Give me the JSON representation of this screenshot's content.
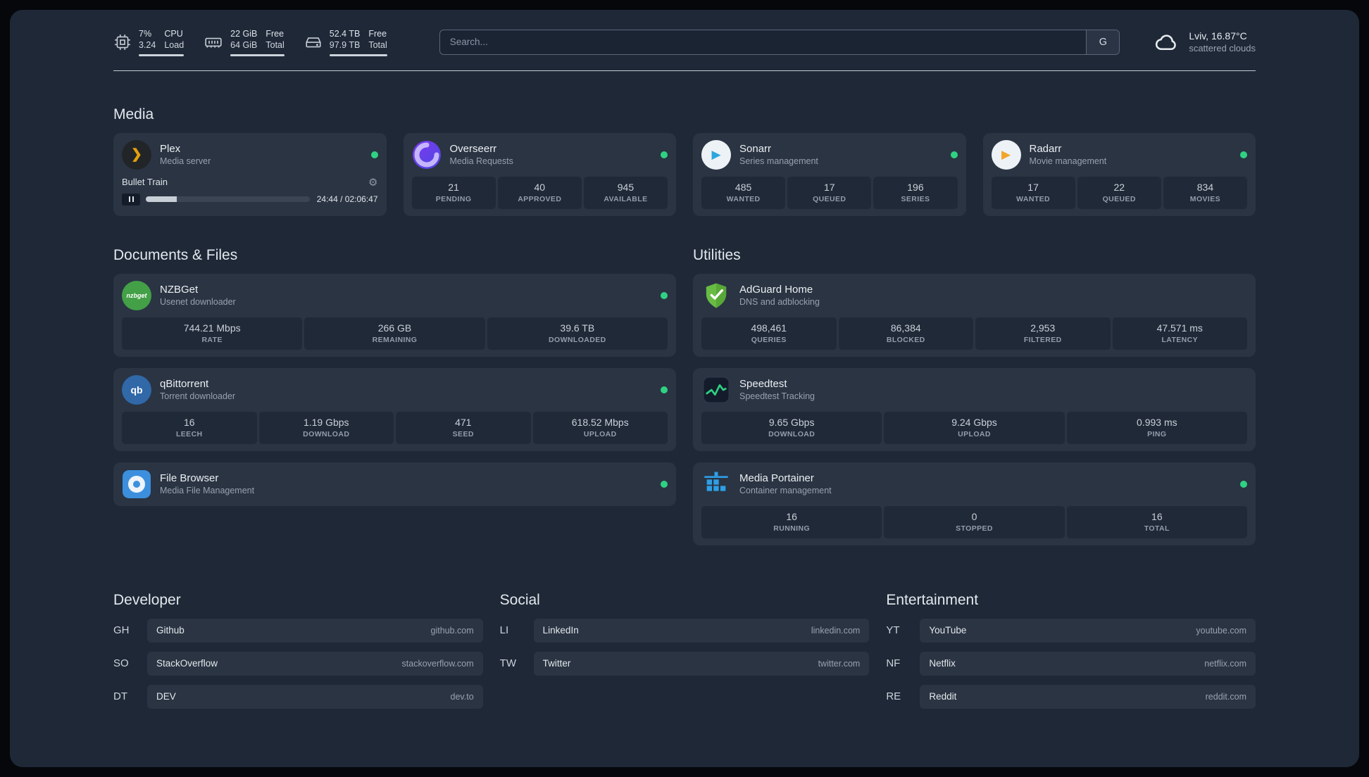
{
  "header": {
    "cpu": {
      "col1": {
        "top": "7%",
        "bottom": "3.24"
      },
      "col2": {
        "top": "CPU",
        "bottom": "Load"
      }
    },
    "memory": {
      "col1": {
        "top": "22 GiB",
        "bottom": "64 GiB"
      },
      "col2": {
        "top": "Free",
        "bottom": "Total"
      }
    },
    "disk": {
      "col1": {
        "top": "52.4 TB",
        "bottom": "97.9 TB"
      },
      "col2": {
        "top": "Free",
        "bottom": "Total"
      }
    },
    "search": {
      "placeholder": "Search...",
      "button": "G"
    },
    "weather": {
      "line1": "Lviv, 16.87°C",
      "line2": "scattered clouds"
    }
  },
  "sections": {
    "media": {
      "title": "Media"
    },
    "documents": {
      "title": "Documents & Files"
    },
    "utilities": {
      "title": "Utilities"
    }
  },
  "services": {
    "plex": {
      "name": "Plex",
      "desc": "Media server",
      "track": "Bullet Train",
      "time": "24:44 / 02:06:47"
    },
    "overseerr": {
      "name": "Overseerr",
      "desc": "Media Requests",
      "stats": [
        {
          "v": "21",
          "l": "PENDING"
        },
        {
          "v": "40",
          "l": "APPROVED"
        },
        {
          "v": "945",
          "l": "AVAILABLE"
        }
      ]
    },
    "sonarr": {
      "name": "Sonarr",
      "desc": "Series management",
      "stats": [
        {
          "v": "485",
          "l": "WANTED"
        },
        {
          "v": "17",
          "l": "QUEUED"
        },
        {
          "v": "196",
          "l": "SERIES"
        }
      ]
    },
    "radarr": {
      "name": "Radarr",
      "desc": "Movie management",
      "stats": [
        {
          "v": "17",
          "l": "WANTED"
        },
        {
          "v": "22",
          "l": "QUEUED"
        },
        {
          "v": "834",
          "l": "MOVIES"
        }
      ]
    },
    "nzbget": {
      "name": "NZBGet",
      "desc": "Usenet downloader",
      "stats": [
        {
          "v": "744.21 Mbps",
          "l": "RATE"
        },
        {
          "v": "266 GB",
          "l": "REMAINING"
        },
        {
          "v": "39.6 TB",
          "l": "DOWNLOADED"
        }
      ]
    },
    "qbittorrent": {
      "name": "qBittorrent",
      "desc": "Torrent downloader",
      "stats": [
        {
          "v": "16",
          "l": "LEECH"
        },
        {
          "v": "1.19 Gbps",
          "l": "DOWNLOAD"
        },
        {
          "v": "471",
          "l": "SEED"
        },
        {
          "v": "618.52 Mbps",
          "l": "UPLOAD"
        }
      ]
    },
    "filebrowser": {
      "name": "File Browser",
      "desc": "Media File Management"
    },
    "adguard": {
      "name": "AdGuard Home",
      "desc": "DNS and adblocking",
      "stats": [
        {
          "v": "498,461",
          "l": "QUERIES"
        },
        {
          "v": "86,384",
          "l": "BLOCKED"
        },
        {
          "v": "2,953",
          "l": "FILTERED"
        },
        {
          "v": "47.571 ms",
          "l": "LATENCY"
        }
      ]
    },
    "speedtest": {
      "name": "Speedtest",
      "desc": "Speedtest Tracking",
      "stats": [
        {
          "v": "9.65 Gbps",
          "l": "DOWNLOAD"
        },
        {
          "v": "9.24 Gbps",
          "l": "UPLOAD"
        },
        {
          "v": "0.993 ms",
          "l": "PING"
        }
      ]
    },
    "portainer": {
      "name": "Media Portainer",
      "desc": "Container management",
      "stats": [
        {
          "v": "16",
          "l": "RUNNING"
        },
        {
          "v": "0",
          "l": "STOPPED"
        },
        {
          "v": "16",
          "l": "TOTAL"
        }
      ]
    }
  },
  "icons": {
    "nzbget_text": "nzbget",
    "qbittorrent_text": "qb"
  },
  "bookmarks": [
    {
      "title": "Developer",
      "items": [
        {
          "abbr": "GH",
          "name": "Github",
          "domain": "github.com"
        },
        {
          "abbr": "SO",
          "name": "StackOverflow",
          "domain": "stackoverflow.com"
        },
        {
          "abbr": "DT",
          "name": "DEV",
          "domain": "dev.to"
        }
      ]
    },
    {
      "title": "Social",
      "items": [
        {
          "abbr": "LI",
          "name": "LinkedIn",
          "domain": "linkedin.com"
        },
        {
          "abbr": "TW",
          "name": "Twitter",
          "domain": "twitter.com"
        }
      ]
    },
    {
      "title": "Entertainment",
      "items": [
        {
          "abbr": "YT",
          "name": "YouTube",
          "domain": "youtube.com"
        },
        {
          "abbr": "NF",
          "name": "Netflix",
          "domain": "netflix.com"
        },
        {
          "abbr": "RE",
          "name": "Reddit",
          "domain": "reddit.com"
        }
      ]
    }
  ],
  "colors": {
    "background": "#1e2837",
    "card": "#2a3443",
    "stat_block": "#202938",
    "status_ok": "#2fd283",
    "plex_amber": "#e5a00d"
  }
}
